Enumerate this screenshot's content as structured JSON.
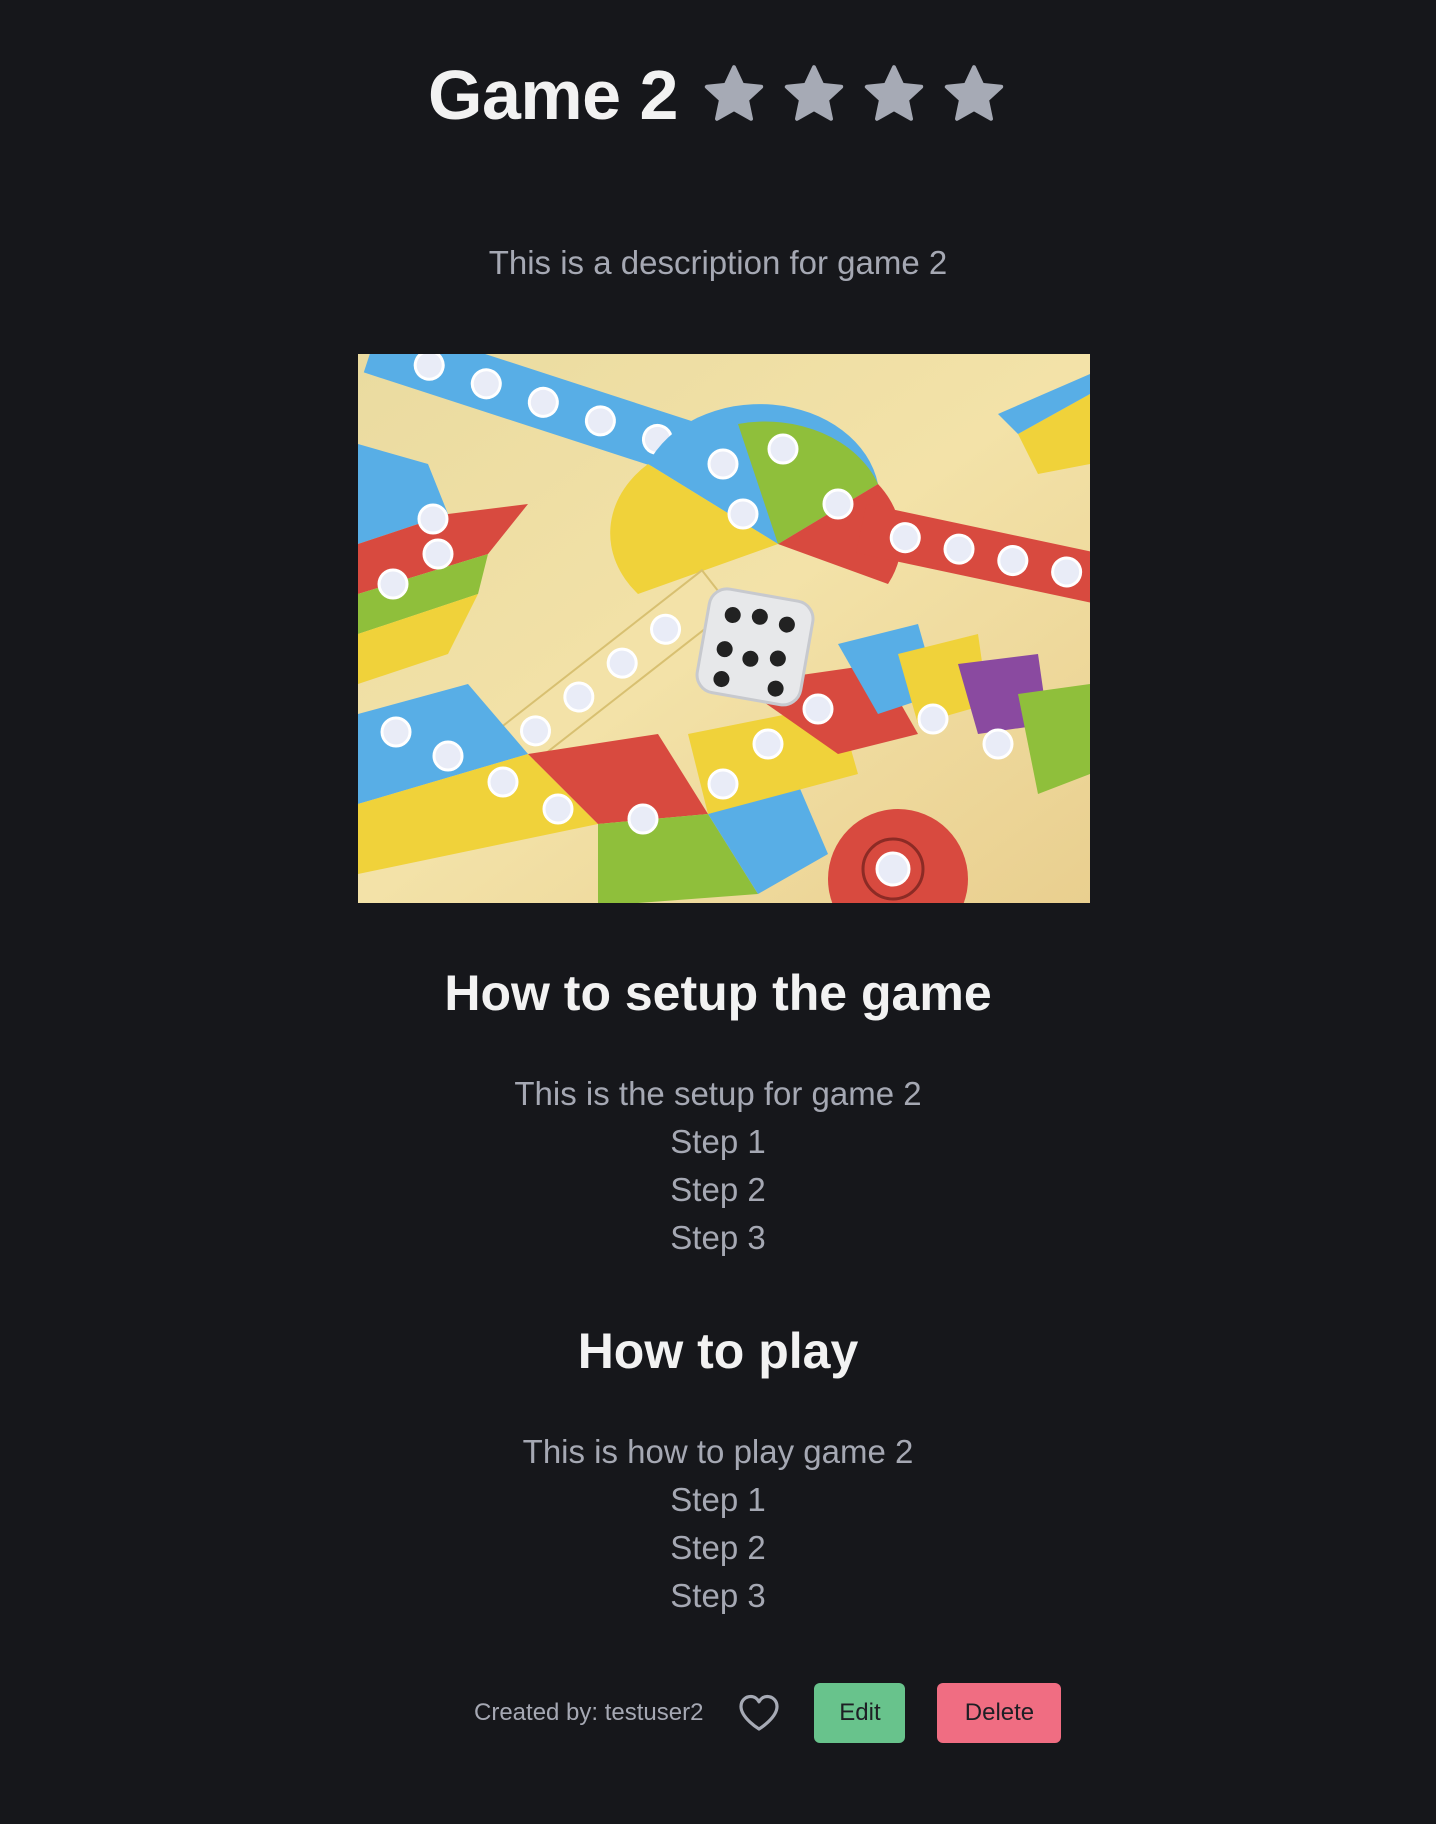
{
  "game": {
    "title": "Game 2",
    "rating_stars": 4,
    "rating_max": 4,
    "description": "This is a description for game 2",
    "image_alt": "ludo-board-with-dice"
  },
  "setup": {
    "heading": "How to setup the game",
    "intro": "This is the setup for game 2",
    "steps": [
      "Step 1",
      "Step 2",
      "Step 3"
    ]
  },
  "play": {
    "heading": "How to play",
    "intro": "This is how to play game 2",
    "steps": [
      "Step 1",
      "Step 2",
      "Step 3"
    ]
  },
  "footer": {
    "created_by": "Created by: testuser2",
    "favorite_icon": "heart-outline-icon",
    "edit_label": "Edit",
    "delete_label": "Delete"
  },
  "colors": {
    "background": "#16171b",
    "title": "#f2f2f2",
    "text": "#a5a8b3",
    "star": "#a6aab5",
    "edit_button": "#68c38c",
    "delete_button": "#f06d82"
  }
}
